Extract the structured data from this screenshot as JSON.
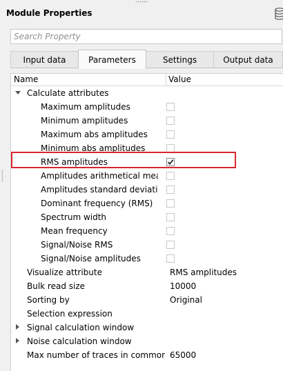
{
  "panel": {
    "title": "Module Properties",
    "icon": "database-icon"
  },
  "search": {
    "placeholder": "Search Property",
    "value": ""
  },
  "tabs": [
    {
      "label": "Input data",
      "active": false
    },
    {
      "label": "Parameters",
      "active": true
    },
    {
      "label": "Settings",
      "active": false
    },
    {
      "label": "Output data",
      "active": false
    }
  ],
  "columns": {
    "name": "Name",
    "value": "Value"
  },
  "group": {
    "label": "Calculate attributes",
    "expanded": true,
    "items": [
      {
        "label": "Maximum amplitudes",
        "checked": false
      },
      {
        "label": "Minimum amplitudes",
        "checked": false
      },
      {
        "label": "Maximum abs amplitudes",
        "checked": false
      },
      {
        "label": "Minimum abs amplitudes",
        "checked": false
      },
      {
        "label": "RMS amplitudes",
        "checked": true
      },
      {
        "label": "Amplitudes arithmetical mean a...",
        "checked": false
      },
      {
        "label": "Amplitudes standard deviation",
        "checked": false
      },
      {
        "label": "Dominant frequency (RMS)",
        "checked": false
      },
      {
        "label": "Spectrum width",
        "checked": false
      },
      {
        "label": "Mean frequency",
        "checked": false
      },
      {
        "label": "Signal/Noise RMS",
        "checked": false
      },
      {
        "label": "Signal/Noise amplitudes",
        "checked": false
      }
    ]
  },
  "props": [
    {
      "label": "Visualize attribute",
      "value": "RMS amplitudes",
      "expandable": false
    },
    {
      "label": "Bulk read size",
      "value": "10000",
      "expandable": false
    },
    {
      "label": "Sorting by",
      "value": "Original",
      "expandable": false
    },
    {
      "label": "Selection expression",
      "value": "",
      "expandable": false
    },
    {
      "label": "Signal calculation window",
      "value": "",
      "expandable": true
    },
    {
      "label": "Noise calculation window",
      "value": "",
      "expandable": true
    },
    {
      "label": "Max number of traces in common ...",
      "value": "65000",
      "expandable": false
    }
  ],
  "highlight_color": "#d9262c"
}
